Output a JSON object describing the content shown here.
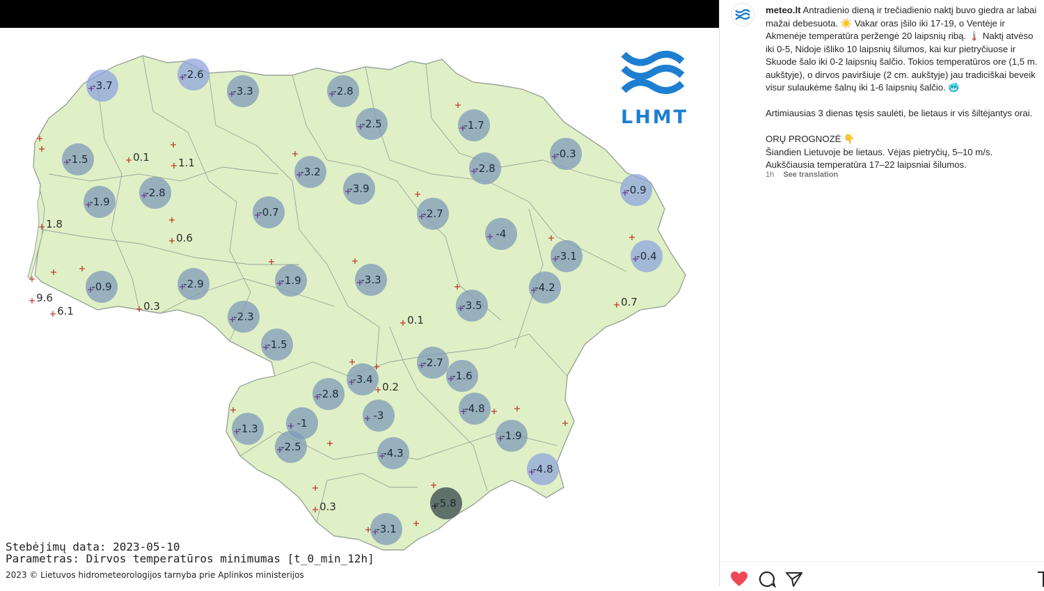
{
  "map": {
    "stations": [
      {
        "v": "-3.7",
        "b": 1,
        "blue": 1
      },
      {
        "v": "-2.6",
        "b": 1,
        "blue": 1
      },
      {
        "v": "-3.3",
        "b": 1
      },
      {
        "v": "-2.8",
        "b": 1
      },
      {
        "v": "-1.5",
        "b": 1
      },
      {
        "v": "0.1",
        "b": 0
      },
      {
        "v": "1.1",
        "b": 0
      },
      {
        "v": "-2.5",
        "b": 1
      },
      {
        "v": "-1.7",
        "b": 1
      },
      {
        "v": "-0.3",
        "b": 1
      },
      {
        "v": "-1.9",
        "b": 1
      },
      {
        "v": "-2.8",
        "b": 1
      },
      {
        "v": "-3.2",
        "b": 1
      },
      {
        "v": "-3.9",
        "b": 1
      },
      {
        "v": "-2.8",
        "b": 1
      },
      {
        "v": "-0.9",
        "b": 1,
        "blue": 1
      },
      {
        "v": "1.8",
        "b": 0
      },
      {
        "v": "0.6",
        "b": 0
      },
      {
        "v": "-0.7",
        "b": 1
      },
      {
        "v": "-2.7",
        "b": 1
      },
      {
        "v": "-4",
        "b": 1
      },
      {
        "v": "-3.1",
        "b": 1
      },
      {
        "v": "-0.4",
        "b": 1,
        "blue": 1
      },
      {
        "v": "-0.9",
        "b": 1
      },
      {
        "v": "-2.9",
        "b": 1
      },
      {
        "v": "-1.9",
        "b": 1
      },
      {
        "v": "-3.3",
        "b": 1
      },
      {
        "v": "-4.2",
        "b": 1
      },
      {
        "v": "-3.5",
        "b": 1
      },
      {
        "v": "9.6",
        "b": 0
      },
      {
        "v": "6.1",
        "b": 0
      },
      {
        "v": "0.3",
        "b": 0
      },
      {
        "v": "-2.3",
        "b": 1
      },
      {
        "v": "0.1",
        "b": 0
      },
      {
        "v": "0.7",
        "b": 0
      },
      {
        "v": "-1.5",
        "b": 1
      },
      {
        "v": "-2.7",
        "b": 1
      },
      {
        "v": "-1.6",
        "b": 1
      },
      {
        "v": "-3.4",
        "b": 1
      },
      {
        "v": "0.2",
        "b": 0
      },
      {
        "v": "-2.8",
        "b": 1
      },
      {
        "v": "-4.8",
        "b": 1
      },
      {
        "v": "-3",
        "b": 1
      },
      {
        "v": "-1",
        "b": 1
      },
      {
        "v": "-1.3",
        "b": 1
      },
      {
        "v": "-1.9",
        "b": 1
      },
      {
        "v": "-2.5",
        "b": 1
      },
      {
        "v": "-4.3",
        "b": 1
      },
      {
        "v": "-4.8",
        "b": 1,
        "blue": 1
      },
      {
        "v": "-5.8",
        "b": 1,
        "dark": 1
      },
      {
        "v": "0.3",
        "b": 0
      },
      {
        "v": "-3.1",
        "b": 1
      }
    ],
    "footer_date": "Stebėjimų data: 2023-05-10",
    "footer_param": "Parametras: Dirvos temperatūros minimumas [t_0_min_12h]",
    "footer_copy": "2023 © Lietuvos hidrometeorologijos tarnyba prie Aplinkos ministerijos",
    "logo_text": "LHMT",
    "colors": {
      "land": "#dff0c6",
      "border": "#9aa39a",
      "bubble": "#7f9bb8",
      "bubble_blue": "#8fa4dc",
      "dark": "#4a5a5a",
      "cross": "#c0392b",
      "logo": "#1e7fd0"
    }
  },
  "post": {
    "username": "meteo.lt",
    "caption_p1": "Antradienio dieną ir trečiadienio naktį buvo giedra ar labai mažai debesuota. ☀️ Vakar oras įšilo iki 17-19, o Ventėje ir Akmenėje temperatūra peržengė 20 laipsnių ribą. 🌡️ Naktį atvėso iki 0-5, Nidoje išliko 10 laipsnių šilumos, kai kur pietryčiuose ir Skuode šalo iki 0-2 laipsnių šalčio. Tokios temperatūros ore (1,5 m. aukštyje), o dirvos paviršiuje (2 cm. aukštyje) jau tradiciškai beveik visur sulaukėme šalnų iki 1-6 laipsnių šalčio. 🥶",
    "caption_p2": "Artimiausias 3 dienas tęsis saulėti, be lietaus ir vis šiltėjantys orai.",
    "caption_p3_title": "ORŲ PROGNOZĖ 👇",
    "caption_p3_line1": "Šiandien Lietuvoje be lietaus. Vėjas pietryčių, 5–10 m/s.",
    "caption_p3_line2": "Aukščiausia temperatūra 17–22 laipsniai šilumos.",
    "time": "1h",
    "see_translation": "See translation"
  }
}
